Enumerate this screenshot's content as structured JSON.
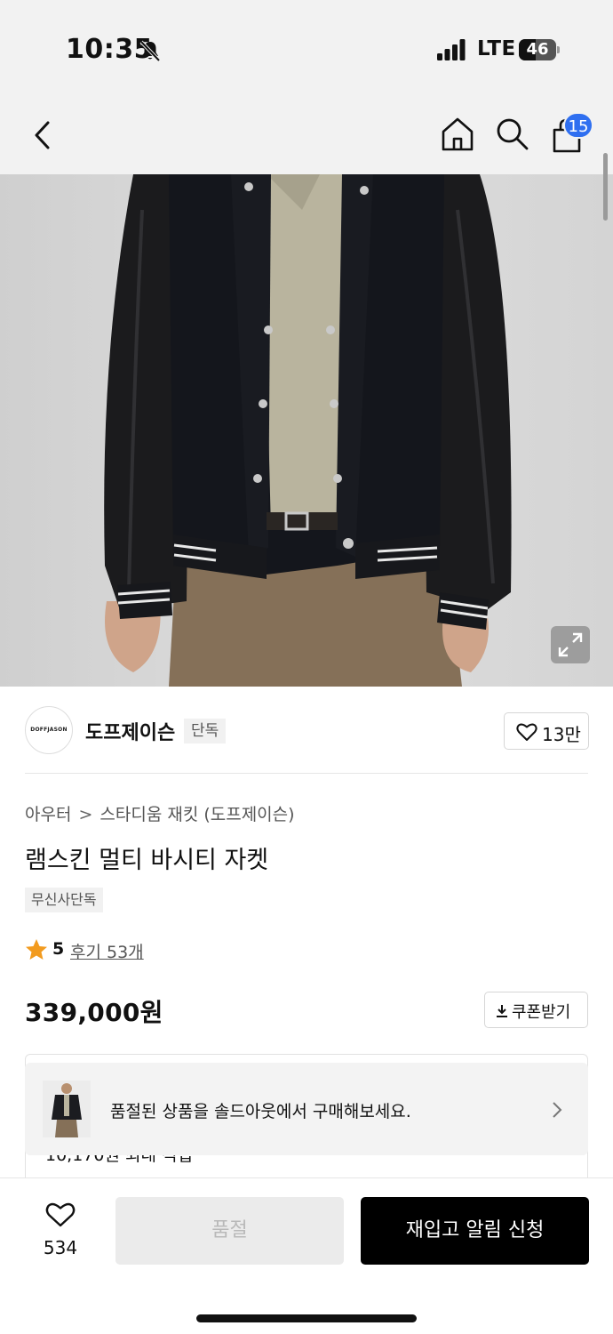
{
  "status_bar": {
    "time": "10:35",
    "network": "LTE",
    "battery": "46",
    "battery_level_fraction": 0.46,
    "icons": [
      "bell-slash-icon",
      "signal-icon",
      "battery-icon"
    ]
  },
  "top_nav": {
    "icons": [
      "chevron-left-icon",
      "home-icon",
      "search-icon",
      "shopping-bag-icon"
    ],
    "cart_count": "15",
    "accent_color": "#2f6ff0"
  },
  "brand": {
    "logo_text": "DOFFJASON",
    "name": "도프제이슨",
    "tag": "단독",
    "like_count": "13만"
  },
  "product": {
    "breadcrumb": [
      "아우터",
      "스타디움 재킷 (도프제이슨)"
    ],
    "title": "램스킨 멀티 바시티 자켓",
    "exclusive_tag": "무신사단독",
    "rating": "5",
    "review_link": "후기 53개",
    "price": "339,000원",
    "coupon_label": "쿠폰받기"
  },
  "soldout_banner": {
    "text": "품절된 상품을 솔드아웃에서 구매해보세요.",
    "partially_hidden_text": "10,170원 최대 적립"
  },
  "bottom_bar": {
    "wish_count": "534",
    "soldout_label": "품절",
    "restock_label": "재입고 알림 신청"
  }
}
